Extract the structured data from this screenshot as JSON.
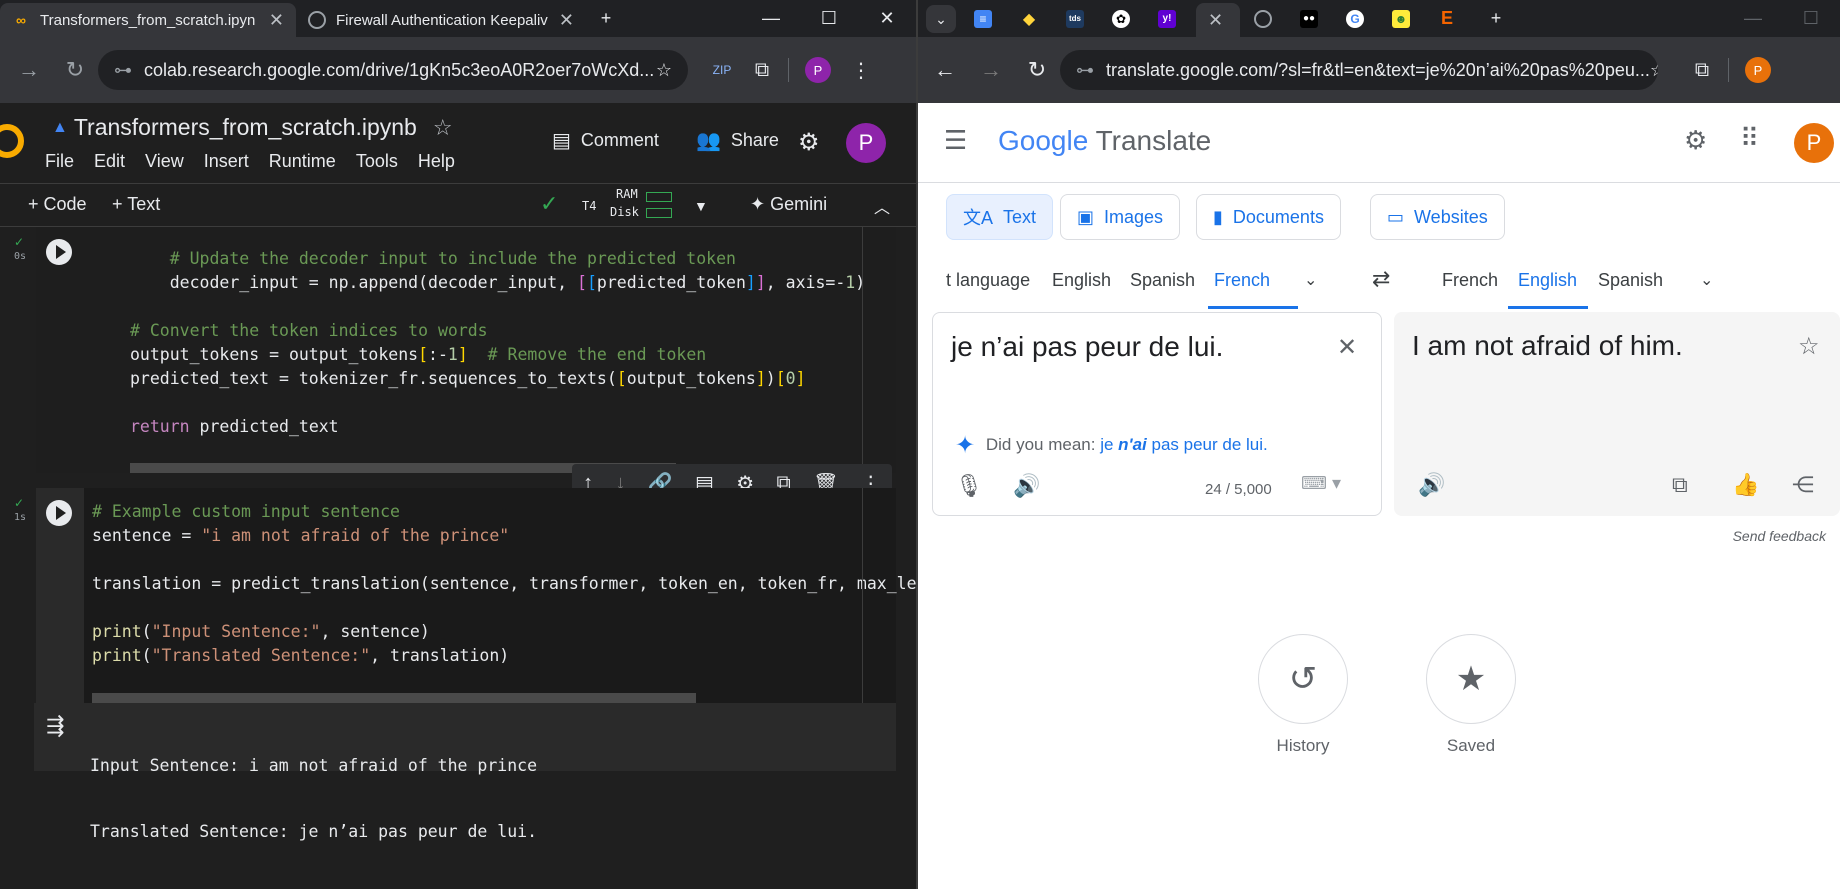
{
  "left_window": {
    "tabs": [
      {
        "title": "Transformers_from_scratch.ipyn",
        "active": true
      },
      {
        "title": "Firewall Authentication Keepaliv",
        "active": false
      }
    ],
    "new_tab": "+",
    "url_site": "⊶",
    "url": "colab.research.google.com/drive/1gKn5c3eoA0R2oer7oWcXd...",
    "profile_initial": "P",
    "colab": {
      "notebook_title": "Transformers_from_scratch.ipynb",
      "menu": [
        "File",
        "Edit",
        "View",
        "Insert",
        "Runtime",
        "Tools",
        "Help"
      ],
      "comment_label": "Comment",
      "share_label": "Share",
      "profile_initial": "P",
      "add_code": "+ Code",
      "add_text": "+ Text",
      "runtime_type": "T4",
      "ram_label": "RAM",
      "disk_label": "Disk",
      "gemini_label": "Gemini",
      "cell1_time": "0s",
      "cell2_time": "1s",
      "output_line1": "Input Sentence: i am not afraid of the prince",
      "output_line2": "Translated Sentence: je n’ai pas peur de lui."
    }
  },
  "right_window": {
    "url": "translate.google.com/?sl=fr&tl=en&text=je%20n’ai%20pas%20peu...",
    "profile_initial": "P",
    "translate": {
      "logo_google": "Google",
      "logo_translate": "Translate",
      "profile_initial": "P",
      "modes": [
        "Text",
        "Images",
        "Documents",
        "Websites"
      ],
      "source_langs": [
        "t language",
        "English",
        "Spanish",
        "French"
      ],
      "target_langs": [
        "French",
        "English",
        "Spanish"
      ],
      "source_text": "je n’ai pas peur de lui.",
      "target_text": "I am not afraid of him.",
      "did_you_mean_label": "Did you mean:",
      "did_you_mean_pre": "je",
      "did_you_mean_bold": "n'ai",
      "did_you_mean_post": "pas peur de lui.",
      "char_count": "24 / 5,000",
      "send_feedback": "Send feedback",
      "history_label": "History",
      "saved_label": "Saved"
    }
  },
  "colors": {
    "colab_accent": "#f9ab00",
    "google_blue": "#1a73e8",
    "avatar_purple": "#8e24aa",
    "avatar_orange": "#e8710a"
  }
}
